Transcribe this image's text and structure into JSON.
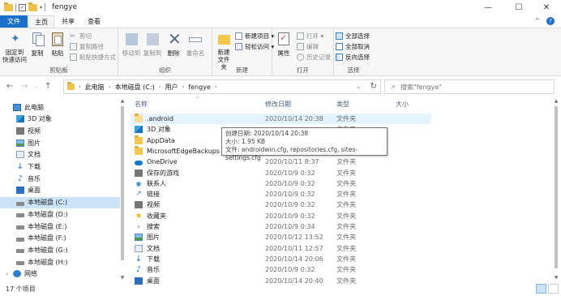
{
  "window": {
    "title": "fengye",
    "minimize_glyph": "—",
    "maximize_glyph": "☐",
    "close_glyph": "✕"
  },
  "tabs": {
    "file": "文件",
    "home": "主页",
    "share": "共享",
    "view": "查看",
    "collapse_glyph": "^",
    "help_glyph": "?"
  },
  "ribbon": {
    "pin_quick_access": "固定到\n快速访问",
    "copy": "复制",
    "paste": "粘贴",
    "cut": "剪切",
    "copy_path": "复制路径",
    "paste_shortcut": "粘贴快捷方式",
    "group_clipboard": "剪贴板",
    "move_to": "移动到",
    "copy_to": "复制到",
    "delete": "删除",
    "rename": "重命名",
    "group_organize": "组织",
    "new_folder": "新建\n文件夹",
    "new_item": "新建项目 ▾",
    "easy_access": "轻松访问 ▾",
    "group_new": "新建",
    "properties": "属性",
    "open": "打开 ▾",
    "edit": "编辑",
    "history": "历史记录",
    "group_open": "打开",
    "select_all": "全部选择",
    "select_none": "全部取消",
    "invert_selection": "反向选择",
    "group_select": "选择"
  },
  "address": {
    "segments": [
      "此电脑",
      "本地磁盘 (C:)",
      "用户",
      "fengye"
    ],
    "search_placeholder": "搜索\"fengye\""
  },
  "nav": [
    {
      "label": "此电脑",
      "icon": "pc-icon"
    },
    {
      "label": "3D 对象",
      "icon": "cube-icon"
    },
    {
      "label": "视频",
      "icon": "video-icon"
    },
    {
      "label": "图片",
      "icon": "picture-icon"
    },
    {
      "label": "文档",
      "icon": "document-icon"
    },
    {
      "label": "下载",
      "icon": "download-icon"
    },
    {
      "label": "音乐",
      "icon": "music-icon"
    },
    {
      "label": "桌面",
      "icon": "desktop-icon"
    },
    {
      "label": "本地磁盘 (C:)",
      "icon": "drive-icon",
      "selected": true
    },
    {
      "label": "本地磁盘 (D:)",
      "icon": "drive-icon"
    },
    {
      "label": "本地磁盘 (E:)",
      "icon": "drive-icon"
    },
    {
      "label": "本地磁盘 (F:)",
      "icon": "drive-icon"
    },
    {
      "label": "本地磁盘 (G:)",
      "icon": "drive-icon"
    },
    {
      "label": "本地磁盘 (H:)",
      "icon": "drive-icon"
    },
    {
      "label": "网络",
      "icon": "network-icon"
    }
  ],
  "columns": {
    "name": "名称",
    "date": "修改日期",
    "type": "类型",
    "size": "大小"
  },
  "files": [
    {
      "name": ".android",
      "date": "2020/10/14 20:38",
      "type": "文件夹",
      "icon": "folder-icon"
    },
    {
      "name": "3D 对象",
      "date": "",
      "type": "文件夹",
      "icon": "cube-icon"
    },
    {
      "name": "AppData",
      "date": "",
      "type": "文件夹",
      "icon": "folder-icon"
    },
    {
      "name": "MicrosoftEdgeBackups",
      "date": "",
      "type": "文件夹",
      "icon": "folder-icon"
    },
    {
      "name": "OneDrive",
      "date": "2020/10/11 8:37",
      "type": "文件夹",
      "icon": "onedrive-icon"
    },
    {
      "name": "保存的游戏",
      "date": "2020/10/9 0:32",
      "type": "文件夹",
      "icon": "saved-games-icon"
    },
    {
      "name": "联系人",
      "date": "2020/10/9 0:32",
      "type": "文件夹",
      "icon": "contacts-icon"
    },
    {
      "name": "链接",
      "date": "2020/10/9 0:32",
      "type": "文件夹",
      "icon": "links-icon"
    },
    {
      "name": "视频",
      "date": "2020/10/9 0:32",
      "type": "文件夹",
      "icon": "video-icon"
    },
    {
      "name": "收藏夹",
      "date": "2020/10/9 0:32",
      "type": "文件夹",
      "icon": "favorites-icon"
    },
    {
      "name": "搜索",
      "date": "2020/10/9 0:34",
      "type": "文件夹",
      "icon": "searches-icon"
    },
    {
      "name": "图片",
      "date": "2020/10/12 13:52",
      "type": "文件夹",
      "icon": "picture-icon"
    },
    {
      "name": "文档",
      "date": "2020/10/11 12:57",
      "type": "文件夹",
      "icon": "document-icon"
    },
    {
      "name": "下载",
      "date": "2020/10/14 20:06",
      "type": "文件夹",
      "icon": "download-icon"
    },
    {
      "name": "音乐",
      "date": "2020/10/9 0:32",
      "type": "文件夹",
      "icon": "music-icon"
    },
    {
      "name": "桌面",
      "date": "2020/10/14 20:40",
      "type": "文件夹",
      "icon": "desktop-icon"
    }
  ],
  "tooltip": {
    "line1": "创建日期: 2020/10/14 20:38",
    "line2": "大小: 1.95 KB",
    "line3": "文件: androidwin.cfg, repositories.cfg, sites-settings.cfg"
  },
  "status": {
    "item_count": "17 个项目"
  },
  "colors": {
    "accent": "#1a6fc9",
    "selection": "#cce4f7",
    "hover": "#e5f3ff",
    "folder": "#f3c64c"
  }
}
